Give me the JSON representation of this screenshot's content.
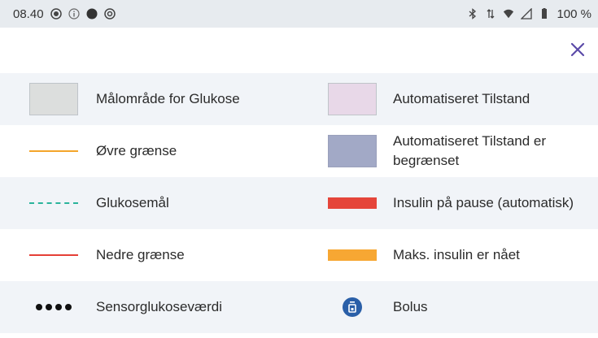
{
  "status_bar": {
    "time": "08.40",
    "battery_percent": "100 %"
  },
  "header": {
    "close_icon": "close-icon"
  },
  "colors": {
    "target_range": "#dcdedd",
    "upper_limit": "#f4a52a",
    "glucose_target": "#2ab39b",
    "lower_limit": "#e53f36",
    "automated_mode": "#e8d8e8",
    "automated_mode_limited": "#a2a9c6",
    "insulin_paused": "#e5453a",
    "max_insulin": "#f7a733",
    "bolus": "#2a5fa8",
    "accent": "#5b4aa8"
  },
  "legend": {
    "left": [
      {
        "label": "Målområde for Glukose",
        "symbol": "swatch-box"
      },
      {
        "label": "Øvre grænse",
        "symbol": "solid-line"
      },
      {
        "label": "Glukosemål",
        "symbol": "dashed-line"
      },
      {
        "label": "Nedre grænse",
        "symbol": "solid-line"
      },
      {
        "label": "Sensorglukoseværdi",
        "symbol": "dots"
      }
    ],
    "right": [
      {
        "label": "Automatiseret Tilstand",
        "symbol": "swatch-box"
      },
      {
        "label": "Automatiseret Tilstand er begrænset",
        "symbol": "swatch-box"
      },
      {
        "label": "Insulin på pause (automatisk)",
        "symbol": "bar"
      },
      {
        "label": "Maks. insulin er nået",
        "symbol": "bar"
      },
      {
        "label": "Bolus",
        "symbol": "bolus-icon"
      }
    ]
  }
}
